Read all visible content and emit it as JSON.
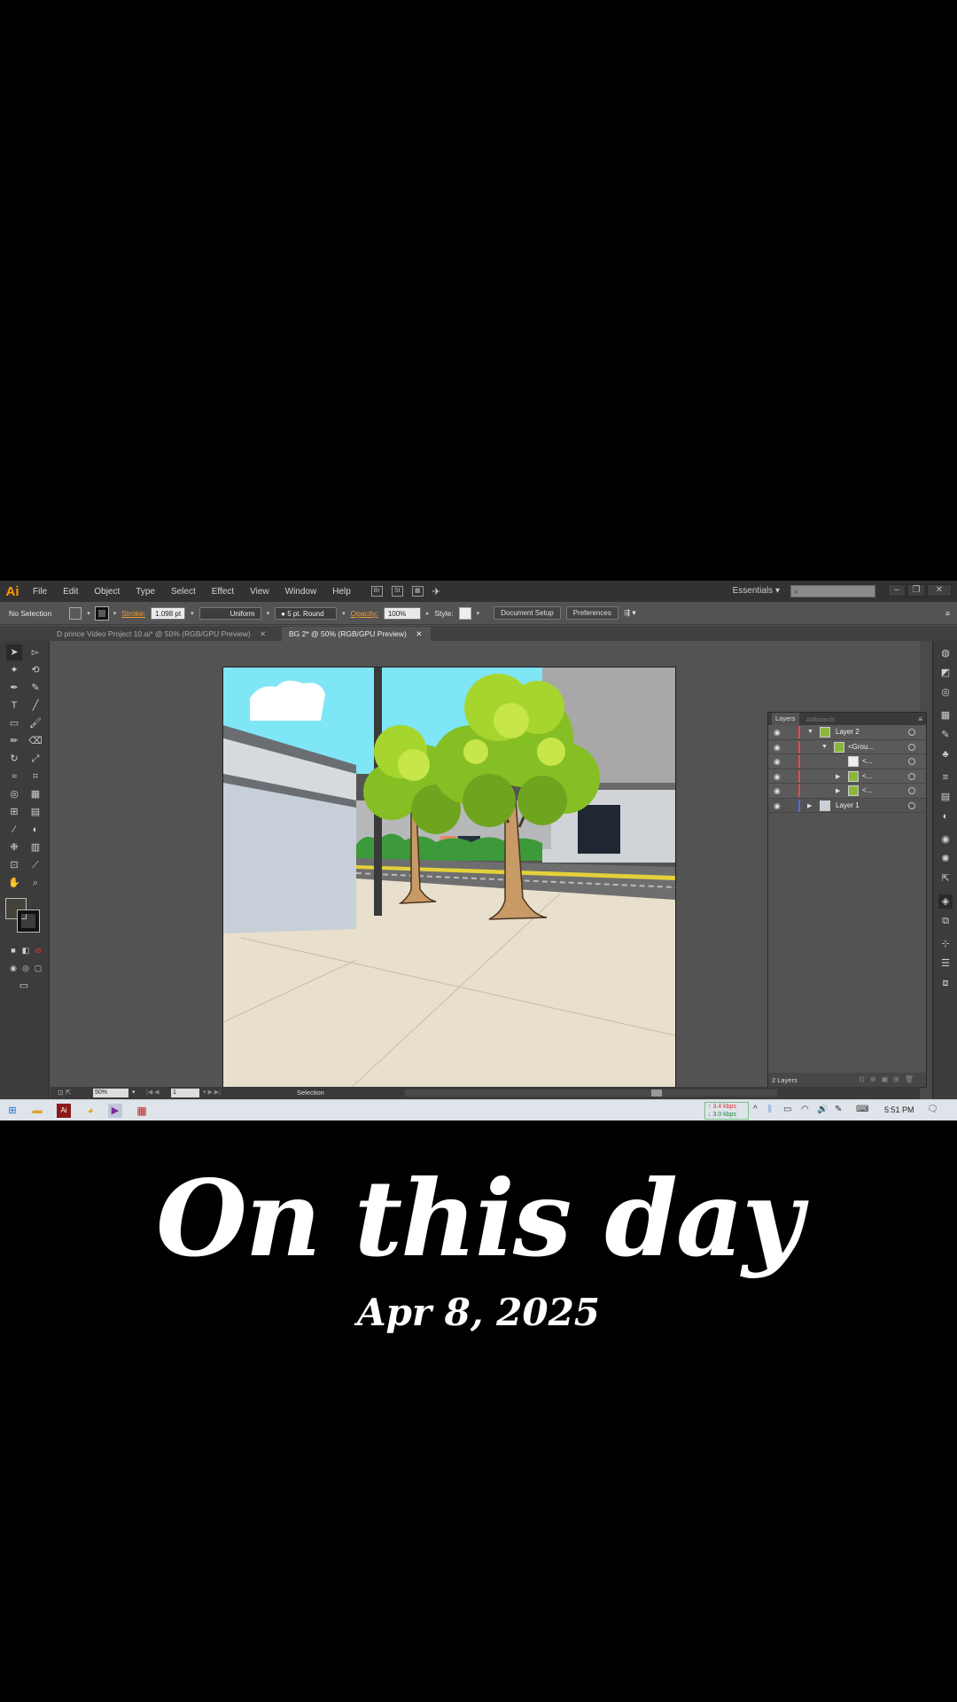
{
  "app": {
    "logo": "Ai",
    "menu": [
      "File",
      "Edit",
      "Object",
      "Type",
      "Select",
      "Effect",
      "View",
      "Window",
      "Help"
    ],
    "menu_icons": [
      "Br",
      "St"
    ],
    "workspace": "Essentials"
  },
  "controlbar": {
    "selection": "No Selection",
    "stroke_label": "Stroke:",
    "stroke_weight": "1.098 pt",
    "profile": "Uniform",
    "brush": "5 pt. Round",
    "opacity_label": "Opacity:",
    "opacity": "100%",
    "style_label": "Style:",
    "document_setup": "Document Setup",
    "preferences": "Preferences"
  },
  "tabs": [
    {
      "label": "D prince Video Project 10.ai* @ 50% (RGB/GPU Preview)",
      "active": false
    },
    {
      "label": "BG 2* @ 50% (RGB/GPU Preview)",
      "active": true
    }
  ],
  "layers_panel": {
    "tabs": [
      "Layers",
      "Artboards"
    ],
    "rows": [
      {
        "name": "Layer 2",
        "color": "#e84a4a"
      },
      {
        "name": "<Grou...",
        "color": "#e84a4a"
      },
      {
        "name": "<...",
        "color": "#e84a4a"
      },
      {
        "name": "<...",
        "color": "#e84a4a"
      },
      {
        "name": "<...",
        "color": "#e84a4a"
      },
      {
        "name": "Layer 1",
        "color": "#4a6ae8"
      }
    ],
    "count": "2 Layers"
  },
  "statusbar": {
    "zoom": "50%",
    "page": "1",
    "tool": "Selection"
  },
  "taskbar": {
    "net_up": "3.4 kbps",
    "net_down": "3.0 kbps",
    "time": "5:51 PM"
  },
  "caption": {
    "title": "On this day",
    "date": "Apr 8, 2025"
  }
}
